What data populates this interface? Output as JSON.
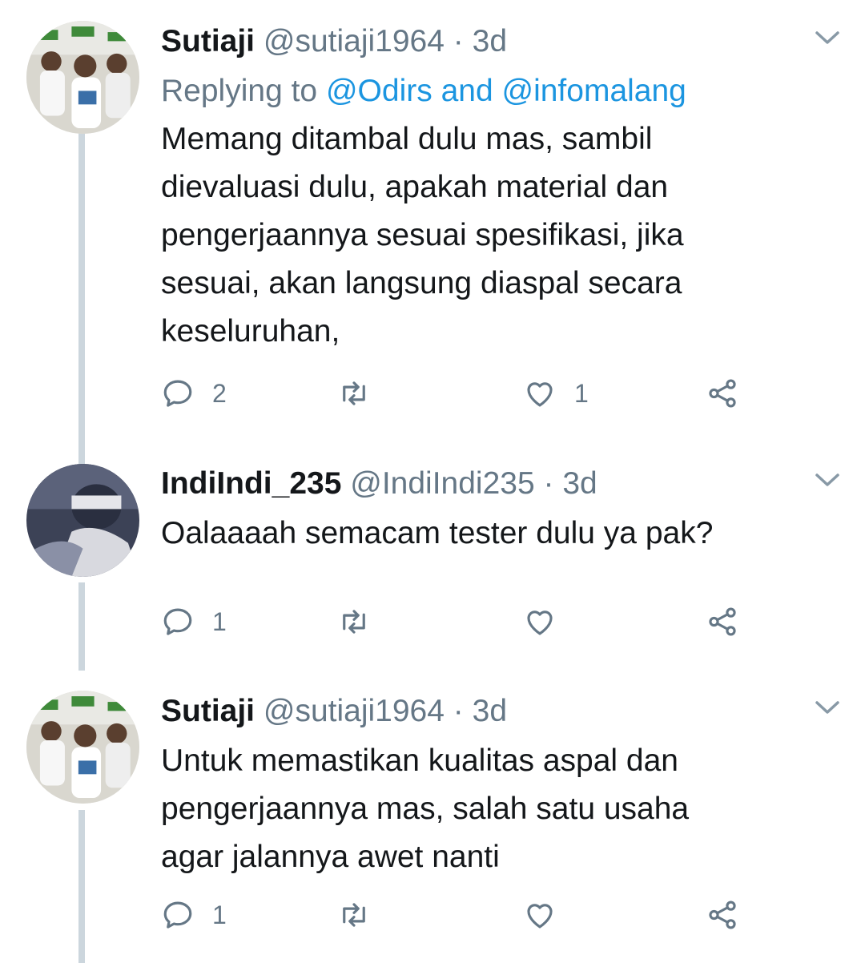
{
  "colors": {
    "text": "#14171a",
    "secondary": "#657786",
    "mention": "#1b95e0",
    "thread_line": "#ccd6dd"
  },
  "tweets": [
    {
      "name": "Sutiaji",
      "handle": "@sutiaji1964",
      "separator": "·",
      "time": "3d",
      "reply_prefix": "Replying to ",
      "reply_user1": "@Odirs",
      "reply_joiner": " and ",
      "reply_user2": "@infomalang",
      "lines": [
        "Memang ditambal dulu mas, sambil",
        "dievaluasi dulu, apakah material dan",
        "pengerjaannya sesuai spesifikasi, jika",
        "sesuai, akan langsung diaspal secara",
        "keseluruhan,"
      ],
      "reply_count": "2",
      "retweet_count": "",
      "like_count": "1",
      "avatar_icon": "profile-photo-group"
    },
    {
      "name": "IndiIndi_235",
      "handle": "@IndiIndi235",
      "separator": "·",
      "time": "3d",
      "lines": [
        "Oalaaaah semacam tester dulu ya pak?"
      ],
      "reply_count": "1",
      "retweet_count": "",
      "like_count": "",
      "avatar_icon": "profile-photo-person"
    },
    {
      "name": "Sutiaji",
      "handle": "@sutiaji1964",
      "separator": "·",
      "time": "3d",
      "lines": [
        "Untuk memastikan kualitas aspal dan",
        "pengerjaannya mas, salah satu usaha",
        "agar jalannya awet nanti"
      ],
      "reply_count": "1",
      "retweet_count": "",
      "like_count": "",
      "avatar_icon": "profile-photo-group"
    }
  ]
}
